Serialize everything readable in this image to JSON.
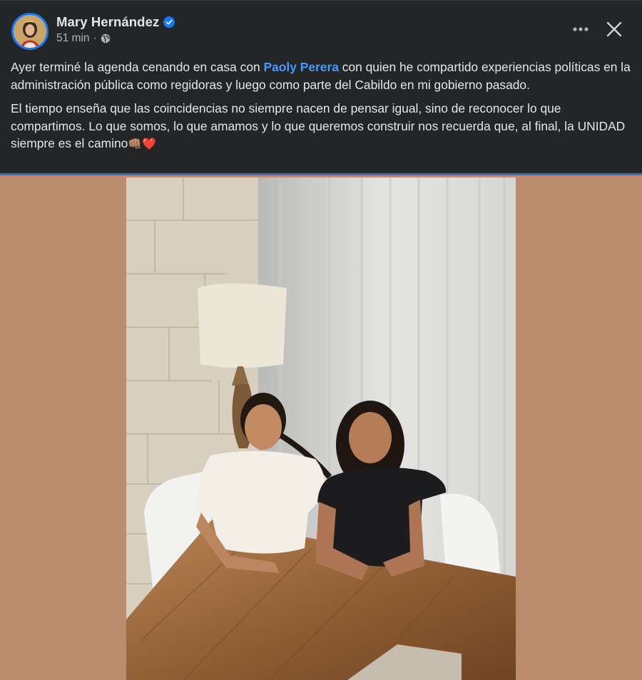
{
  "post": {
    "author": "Mary Hernández",
    "timestamp": "51 min",
    "meta_separator": "·",
    "paragraph1": {
      "before": "Ayer terminé la agenda cenando en casa con ",
      "mention": "Paoly Perera",
      "after": " con quien he compartido experiencias políticas en la administración pública como regidoras y luego como parte del Cabildo en mi gobierno pasado."
    },
    "paragraph2": {
      "text": "El tiempo enseña que las coincidencias no siempre nacen de pensar igual, sino de reconocer lo que compartimos. Lo que somos, lo que amamos y lo que queremos construir nos recuerda que, al final, la UNIDAD siempre es el camino",
      "emoji1": "👊🏽",
      "emoji2": "❤️"
    }
  },
  "icons": {
    "verified": "verified-badge-icon",
    "audience": "globe-icon",
    "more": "more-options-icon",
    "close": "close-icon"
  },
  "colors": {
    "header_background": "#242526",
    "mention": "#4599ff",
    "verified": "#1877f2",
    "photo_backdrop": "#bc8a6c"
  }
}
